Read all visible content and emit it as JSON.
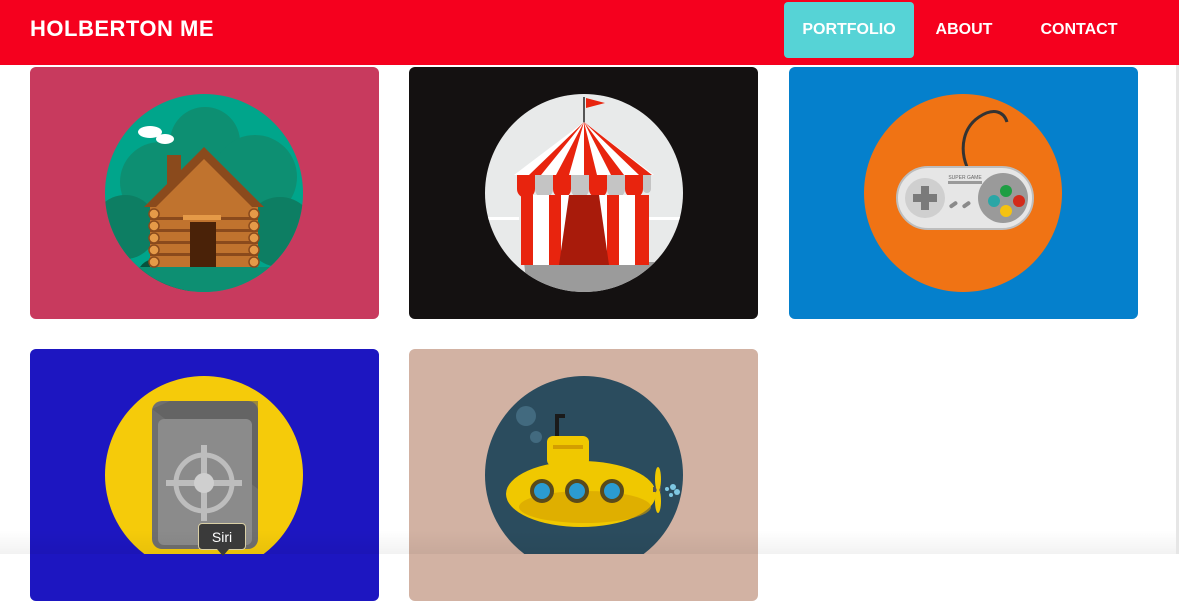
{
  "header": {
    "brand": "HOLBERTON ME",
    "nav": [
      {
        "label": "PORTFOLIO",
        "active": true
      },
      {
        "label": "ABOUT",
        "active": false
      },
      {
        "label": "CONTACT",
        "active": false
      }
    ]
  },
  "colors": {
    "header_bg": "#f5001e",
    "active_nav_bg": "#56d3d6"
  },
  "portfolio": [
    {
      "icon": "log-cabin-icon",
      "bg": "#c83a5e",
      "circle": "#00a58b"
    },
    {
      "icon": "circus-tent-icon",
      "bg": "#141111",
      "circle": "#e8eaea"
    },
    {
      "icon": "game-controller-icon",
      "bg": "#0580cc",
      "circle": "#f07314"
    },
    {
      "icon": "safe-icon",
      "bg": "#1d16c1",
      "circle": "#f5cb0a"
    },
    {
      "icon": "submarine-icon",
      "bg": "#d2b2a3",
      "circle": "#2b4c5e"
    }
  ],
  "controller_text": "SUPER GAME",
  "tooltip": {
    "text": "Siri"
  }
}
